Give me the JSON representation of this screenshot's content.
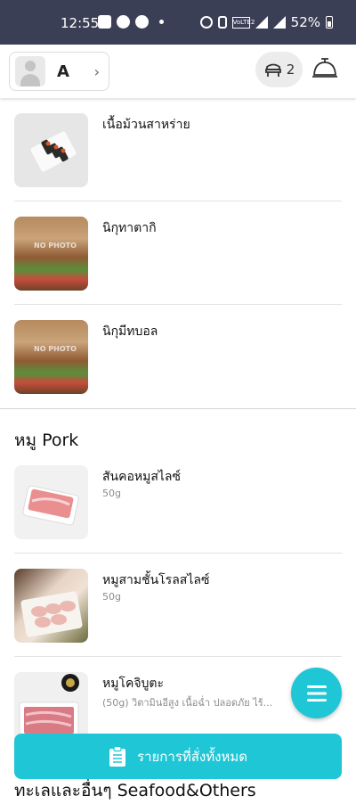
{
  "status_bar": {
    "time": "12:55",
    "battery": "52%",
    "network_badge": "VoLTE2"
  },
  "header": {
    "profile_initial": "A",
    "table_count": "2"
  },
  "sections": [
    {
      "title": "",
      "items": [
        {
          "name": "เนื้อม้วนสาหร่าย",
          "desc": "",
          "image": "sushi-rolls"
        },
        {
          "name": "นิกุทาตากิ",
          "desc": "",
          "image": "no-photo",
          "placeholder_text": "NO PHOTO"
        },
        {
          "name": "นิกุมีทบอล",
          "desc": "",
          "image": "no-photo",
          "placeholder_text": "NO PHOTO"
        }
      ]
    },
    {
      "title": "หมู Pork",
      "items": [
        {
          "name": "สันคอหมูสไลซ์",
          "desc": "50g",
          "image": "pork-slices"
        },
        {
          "name": "หมูสามชั้นโรลสไลซ์",
          "desc": "50g",
          "image": "pork-belly-roll"
        },
        {
          "name": "หมูโคจิบูตะ",
          "desc": "(50g) วิตามินอีสูง เนื้อฉ่ำ ปลอดภัย ไร้...",
          "image": "koji-pork"
        }
      ]
    }
  ],
  "next_section_title": "ทะเลและอื่นๆ Seafood&Others",
  "bottom_bar": {
    "label": "รายการที่สั่งทั้งหมด"
  },
  "colors": {
    "accent": "#1fc6d6",
    "status_bar": "#3b3f55"
  }
}
